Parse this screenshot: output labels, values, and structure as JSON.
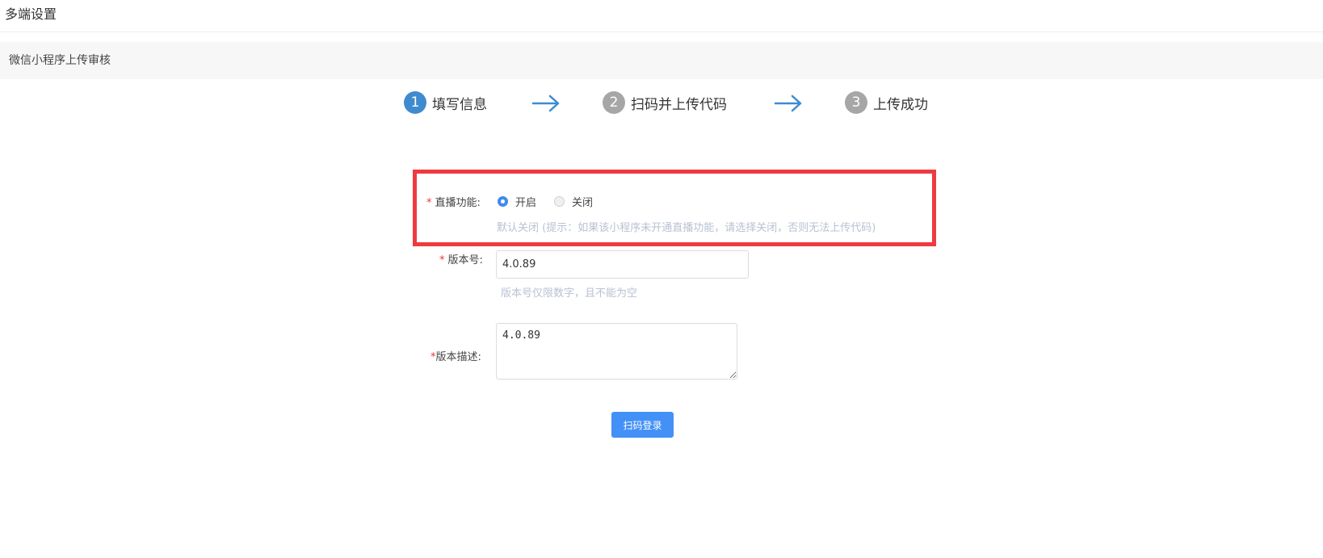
{
  "header": {
    "title": "多端设置"
  },
  "section": {
    "title": "微信小程序上传审核"
  },
  "steps": [
    {
      "num": "1",
      "label": "填写信息",
      "state": "active"
    },
    {
      "num": "2",
      "label": "扫码并上传代码",
      "state": "inactive"
    },
    {
      "num": "3",
      "label": "上传成功",
      "state": "inactive"
    }
  ],
  "form": {
    "required_mark": "*",
    "live": {
      "label": "直播功能:",
      "options": [
        {
          "label": "开启",
          "checked": true
        },
        {
          "label": "关闭",
          "checked": false
        }
      ],
      "hint": "默认关闭 (提示：如果该小程序未开通直播功能，请选择关闭，否则无法上传代码)"
    },
    "version": {
      "label": "版本号:",
      "value": "4.0.89",
      "hint": "版本号仅限数字，且不能为空"
    },
    "description": {
      "label": "版本描述:",
      "value": "4.0.89"
    },
    "submit_label": "扫码登录"
  },
  "colors": {
    "accent": "#3f8bd0",
    "button": "#4390f7",
    "highlight": "#ef3a3f",
    "hint": "#b8c2d3"
  }
}
